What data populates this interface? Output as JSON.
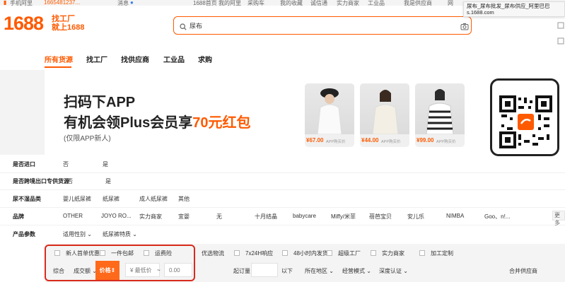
{
  "topbar": {
    "items": [
      "手机阿里",
      "1665481237...",
      "消息",
      "1688首页",
      "我的阿里",
      "采购车",
      "我的收藏",
      "诚信通",
      "实力商家",
      "工业品",
      "我是供应商",
      "网"
    ]
  },
  "tooltip": {
    "title": "尿布_尿布批发_尿布供应_阿里巴巴",
    "url": "s.1688.com"
  },
  "header": {
    "logo": "1688",
    "slogan_line1": "找工厂",
    "slogan_line2": "就上1688",
    "search_value": "尿布"
  },
  "nav": {
    "tabs": [
      "所有货源",
      "找工厂",
      "找供应商",
      "工业品",
      "求购"
    ],
    "active_index": 0
  },
  "banner": {
    "line1": "扫码下APP",
    "line2_prefix": "有机会领Plus会员享",
    "line2_highlight": "70元红包",
    "line3": "(仅限APP新人)",
    "products": [
      {
        "price": "¥67.00",
        "tag": "APP购买价"
      },
      {
        "price": "¥44.00",
        "tag": "APP购买价"
      },
      {
        "price": "¥99.00",
        "tag": "APP购买价"
      }
    ]
  },
  "filters": [
    {
      "label": "是否进口",
      "options": [
        "否",
        "是"
      ]
    },
    {
      "label": "是否跨境出口专供货源",
      "options": [
        "否",
        "是"
      ]
    },
    {
      "label": "尿不湿品类",
      "options": [
        "婴儿纸尿裤",
        "纸尿裤",
        "成人纸尿裤",
        "其他"
      ]
    },
    {
      "label": "品牌",
      "options": [
        "OTHER",
        "JOYO RO...",
        "实力商家",
        "宜婴",
        "无",
        "十月结晶",
        "babycare",
        "Miffy/米菲",
        "蓓芭宝贝",
        "安儿乐",
        "NIMBA",
        "Goo、n!..."
      ]
    },
    {
      "label": "产品参数",
      "options": [
        "适用性别",
        "纸尿裤特质"
      ]
    }
  ],
  "more_label": "更多",
  "checkboxes": [
    "新人首单优惠",
    "一件包邮",
    "运费险",
    "优选物流",
    "7x24H响应",
    "48小时内发货",
    "超级工厂",
    "实力商家",
    "加工定制"
  ],
  "sortbar": {
    "comprehensive": "综合",
    "volume": "成交额",
    "price": "价格",
    "min_price_placeholder": "¥ 最低价",
    "range_sep": "~",
    "max_price_placeholder": "0.00",
    "moq_label": "起订量",
    "moq_suffix": "以下",
    "region": "所在地区",
    "business_mode": "经营模式",
    "certification": "深度认证",
    "merge_supplier": "合并供应商"
  },
  "colors": {
    "brand": "#ff5a00",
    "highlight_box": "#d92a1c"
  }
}
